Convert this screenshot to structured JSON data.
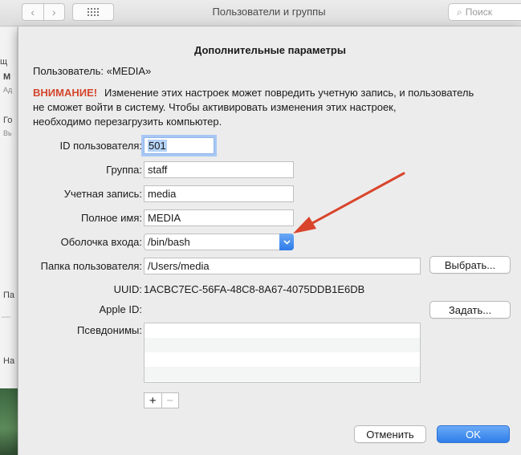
{
  "window": {
    "title": "Пользователи и группы",
    "search_placeholder": "Поиск",
    "back_glyph": "‹",
    "forward_glyph": "›",
    "search_glyph": "⌕"
  },
  "background_fragments": [
    "щ",
    "М",
    "Ад",
    "Го",
    "Вь",
    "Па",
    "—",
    "На"
  ],
  "sheet": {
    "title": "Дополнительные параметры",
    "user_line": "Пользователь:  «MEDIA»",
    "warning": {
      "label": "ВНИМАНИЕ!",
      "lines": [
        "Изменение этих настроек может повредить учетную запись, и пользователь",
        "не сможет войти в систему. Чтобы активировать изменения этих настроек,",
        "необходимо перезагрузить компьютер."
      ]
    },
    "fields": {
      "user_id": {
        "label": "ID пользователя:",
        "value": "501"
      },
      "group": {
        "label": "Группа:",
        "value": "staff"
      },
      "account": {
        "label": "Учетная запись:",
        "value": "media"
      },
      "full_name": {
        "label": "Полное имя:",
        "value": "MEDIA"
      },
      "shell": {
        "label": "Оболочка входа:",
        "value": "/bin/bash"
      },
      "home": {
        "label": "Папка пользователя:",
        "value": "/Users/media"
      },
      "uuid": {
        "label": "UUID:",
        "value": "1ACBC7EC-56FA-48C8-8A67-4075DDB1E6DB"
      },
      "apple_id": {
        "label": "Apple ID:",
        "value": ""
      },
      "aliases": {
        "label": "Псевдонимы:",
        "items": []
      }
    },
    "buttons": {
      "choose": "Выбрать...",
      "set": "Задать...",
      "add": "+",
      "remove": "−",
      "cancel": "Отменить",
      "ok": "OK"
    }
  },
  "colors": {
    "warning": "#d4462b",
    "accent_blue": "#2f7be8",
    "annotation_arrow": "#d9452b"
  },
  "icons": {
    "popup_arrow": "chevron-down-icon",
    "annotation": "arrow-annotation-icon"
  }
}
